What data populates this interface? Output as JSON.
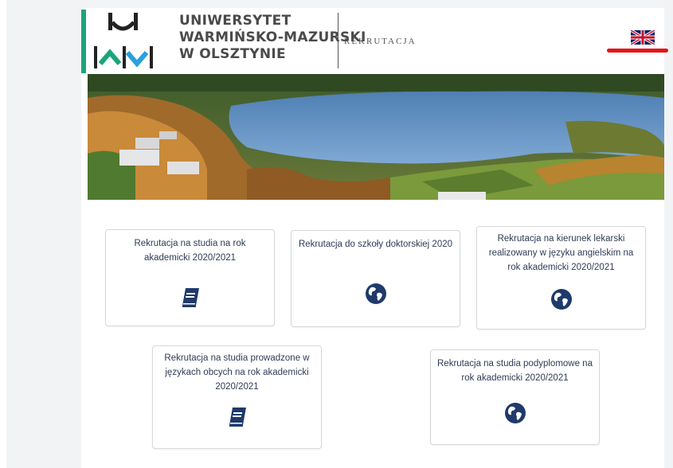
{
  "header": {
    "university_name_lines": [
      "UNIWERSYTET",
      "WARMIŃSKO-MAZURSKI",
      "W OLSZTYNIE"
    ],
    "section_label": "REKRUTACJA",
    "language_flag": "uk-flag-icon",
    "colors": {
      "accent": "#1aa57a",
      "highlight": "#e3151a",
      "text": "#4a4a4a"
    }
  },
  "cards": [
    {
      "label": "Rekrutacja na studia na rok akademicki 2020/2021",
      "icon": "book-icon"
    },
    {
      "label": "Rekrutacja do szkoły doktorskiej 2020",
      "icon": "globe-icon"
    },
    {
      "label": "Rekrutacja na kierunek lekarski realizowany w języku angielskim na rok akademicki 2020/2021",
      "icon": "globe-icon"
    },
    {
      "label": "Rekrutacja na studia prowadzone w językach obcych na rok akademicki 2020/2021",
      "icon": "book-icon"
    },
    {
      "label": "Rekrutacja na studia podyplomowe na rok akademicki 2020/2021",
      "icon": "globe-icon"
    }
  ],
  "colors": {
    "card_text": "#2f3b55",
    "icon": "#1f3a6b"
  }
}
